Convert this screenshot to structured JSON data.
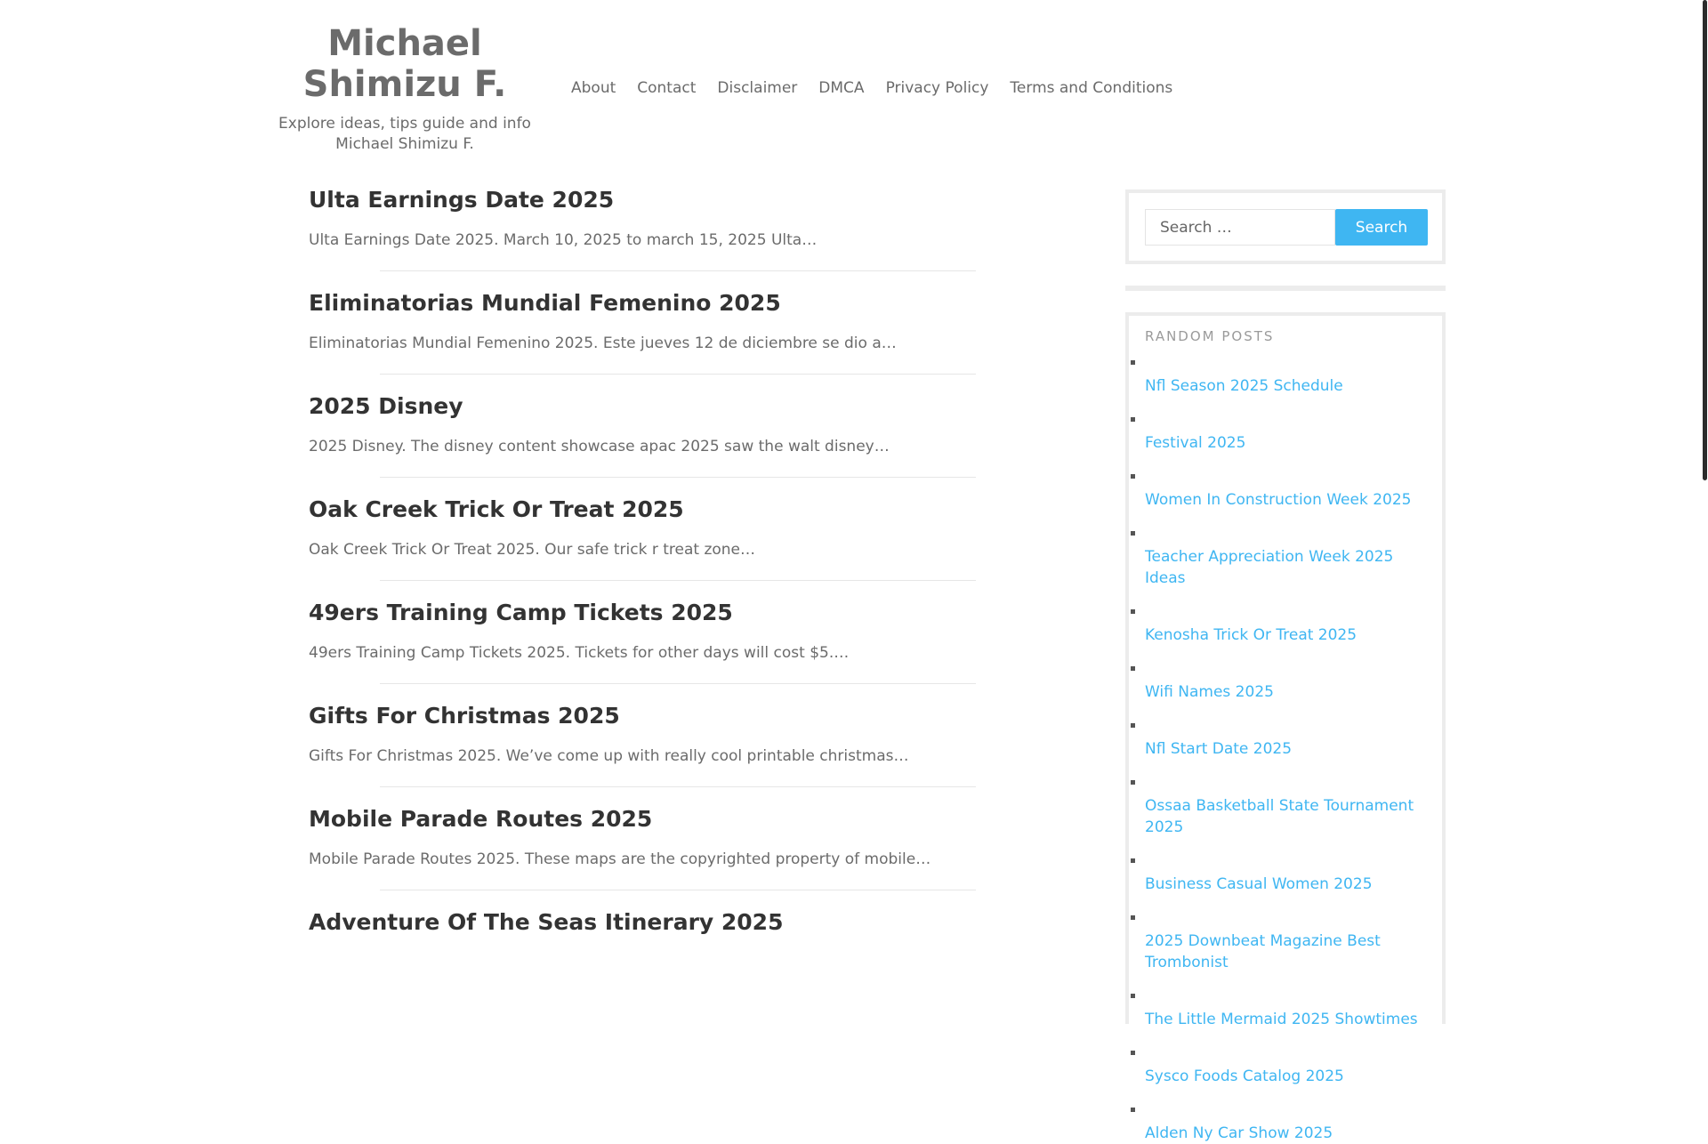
{
  "site": {
    "title": "Michael Shimizu F.",
    "description": "Explore ideas, tips guide and info Michael Shimizu F."
  },
  "nav": {
    "items": [
      "About",
      "Contact",
      "Disclaimer",
      "DMCA",
      "Privacy Policy",
      "Terms and Conditions"
    ]
  },
  "posts": [
    {
      "title": "Ulta Earnings Date 2025",
      "excerpt": "Ulta Earnings Date 2025. March 10, 2025 to march 15, 2025 Ulta…"
    },
    {
      "title": "Eliminatorias Mundial Femenino 2025",
      "excerpt": "Eliminatorias Mundial Femenino 2025. Este jueves 12 de diciembre se dio a…"
    },
    {
      "title": "2025 Disney",
      "excerpt": "2025 Disney. The disney content showcase apac 2025 saw the walt disney…"
    },
    {
      "title": "Oak Creek Trick Or Treat 2025",
      "excerpt": "Oak Creek Trick Or Treat 2025. Our safe trick r treat zone…"
    },
    {
      "title": "49ers Training Camp Tickets 2025",
      "excerpt": "49ers Training Camp Tickets 2025. Tickets for other days will cost $5.…"
    },
    {
      "title": "Gifts For Christmas 2025",
      "excerpt": "Gifts For Christmas 2025. We’ve come up with really cool printable christmas…"
    },
    {
      "title": "Mobile Parade Routes 2025",
      "excerpt": "Mobile Parade Routes 2025. These maps are the copyrighted property of mobile…"
    },
    {
      "title": "Adventure Of The Seas Itinerary 2025",
      "excerpt": ""
    }
  ],
  "search": {
    "placeholder": "Search …",
    "button_label": "Search"
  },
  "random_posts": {
    "title": "RANDOM POSTS",
    "items": [
      "Nfl Season 2025 Schedule",
      "Festival 2025",
      "Women In Construction Week 2025",
      "Teacher Appreciation Week 2025 Ideas",
      "Kenosha Trick Or Treat 2025",
      "Wifi Names 2025",
      "Nfl Start Date 2025",
      "Ossaa Basketball State Tournament 2025",
      "Business Casual Women 2025",
      "2025 Downbeat Magazine Best Trombonist",
      "The Little Mermaid 2025 Showtimes",
      "Sysco Foods Catalog 2025",
      "Alden Ny Car Show 2025"
    ]
  },
  "colors": {
    "link": "#3fb6f2",
    "button": "#3fb6f2",
    "text": "#6b6b6b",
    "heading": "#333333"
  }
}
